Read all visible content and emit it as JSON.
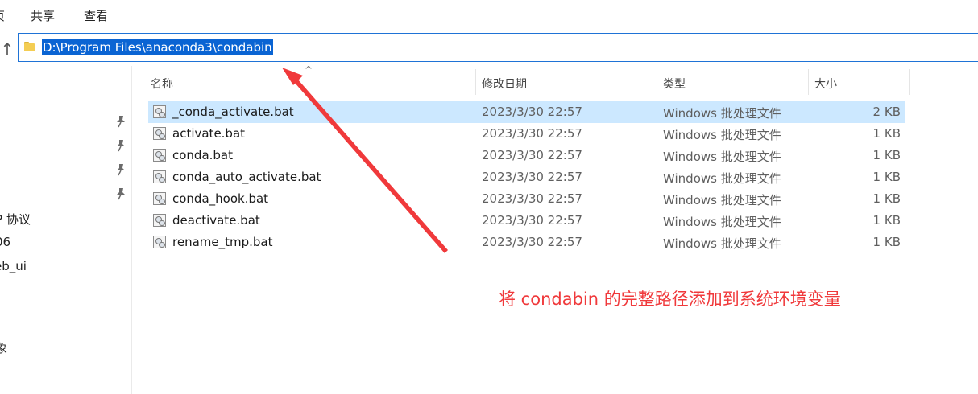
{
  "ribbon": {
    "tabs": [
      "页",
      "共享",
      "查看"
    ]
  },
  "address": {
    "path": "D:\\Program Files\\anaconda3\\condabin"
  },
  "nav": {
    "items": [
      "l",
      "P 协议",
      "06",
      "eb_ui",
      "象"
    ]
  },
  "columns": {
    "name": "名称",
    "date": "修改日期",
    "type": "类型",
    "size": "大小"
  },
  "files": [
    {
      "name": "_conda_activate.bat",
      "date": "2023/3/30 22:57",
      "type": "Windows 批处理文件",
      "size": "2 KB",
      "selected": true
    },
    {
      "name": "activate.bat",
      "date": "2023/3/30 22:57",
      "type": "Windows 批处理文件",
      "size": "1 KB"
    },
    {
      "name": "conda.bat",
      "date": "2023/3/30 22:57",
      "type": "Windows 批处理文件",
      "size": "1 KB"
    },
    {
      "name": "conda_auto_activate.bat",
      "date": "2023/3/30 22:57",
      "type": "Windows 批处理文件",
      "size": "1 KB"
    },
    {
      "name": "conda_hook.bat",
      "date": "2023/3/30 22:57",
      "type": "Windows 批处理文件",
      "size": "1 KB"
    },
    {
      "name": "deactivate.bat",
      "date": "2023/3/30 22:57",
      "type": "Windows 批处理文件",
      "size": "1 KB"
    },
    {
      "name": "rename_tmp.bat",
      "date": "2023/3/30 22:57",
      "type": "Windows 批处理文件",
      "size": "1 KB"
    }
  ],
  "annotation": {
    "text": "将 condabin 的完整路径添加到系统环境变量",
    "color": "#f0393b"
  },
  "colors": {
    "selection": "#cce8ff",
    "address_highlight": "#0a64d3",
    "address_border": "#1f73d6"
  },
  "icons": {
    "up": "up-arrow-icon",
    "folder": "folder-icon",
    "pin": "pin-icon",
    "file": "batch-file-icon",
    "sort": "sort-ascending-icon"
  }
}
